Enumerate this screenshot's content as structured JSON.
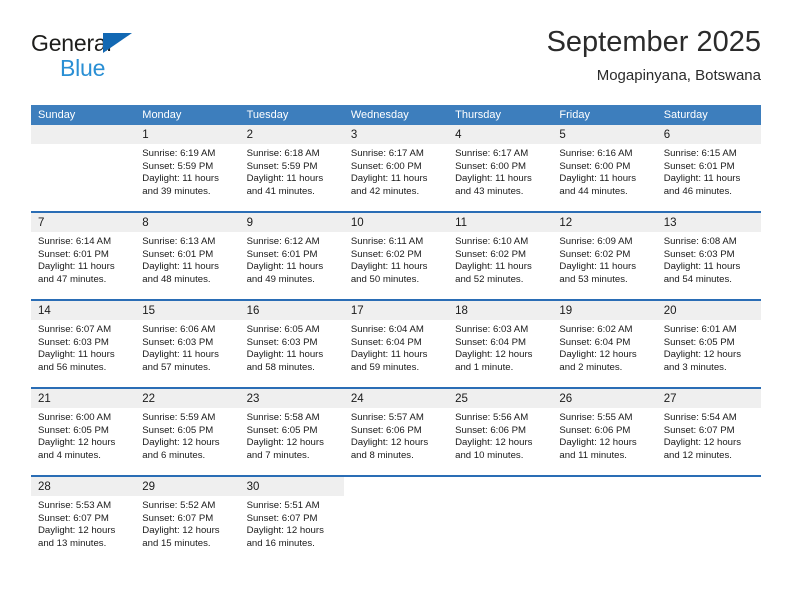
{
  "brand": {
    "line1": "General",
    "line2": "Blue",
    "triangle_color": "#1268b3",
    "blue_text_color": "#2a8fd4"
  },
  "header": {
    "title": "September 2025",
    "subtitle": "Mogapinyana, Botswana"
  },
  "theme": {
    "header_row_bg": "#3d7ebd",
    "week_divider": "#2a6db5",
    "day_number_band": "#efefef"
  },
  "weekdays": [
    "Sunday",
    "Monday",
    "Tuesday",
    "Wednesday",
    "Thursday",
    "Friday",
    "Saturday"
  ],
  "weeks": [
    [
      {
        "day": "",
        "blank": true
      },
      {
        "day": "1",
        "sunrise": "Sunrise: 6:19 AM",
        "sunset": "Sunset: 5:59 PM",
        "daylight1": "Daylight: 11 hours",
        "daylight2": "and 39 minutes."
      },
      {
        "day": "2",
        "sunrise": "Sunrise: 6:18 AM",
        "sunset": "Sunset: 5:59 PM",
        "daylight1": "Daylight: 11 hours",
        "daylight2": "and 41 minutes."
      },
      {
        "day": "3",
        "sunrise": "Sunrise: 6:17 AM",
        "sunset": "Sunset: 6:00 PM",
        "daylight1": "Daylight: 11 hours",
        "daylight2": "and 42 minutes."
      },
      {
        "day": "4",
        "sunrise": "Sunrise: 6:17 AM",
        "sunset": "Sunset: 6:00 PM",
        "daylight1": "Daylight: 11 hours",
        "daylight2": "and 43 minutes."
      },
      {
        "day": "5",
        "sunrise": "Sunrise: 6:16 AM",
        "sunset": "Sunset: 6:00 PM",
        "daylight1": "Daylight: 11 hours",
        "daylight2": "and 44 minutes."
      },
      {
        "day": "6",
        "sunrise": "Sunrise: 6:15 AM",
        "sunset": "Sunset: 6:01 PM",
        "daylight1": "Daylight: 11 hours",
        "daylight2": "and 46 minutes."
      }
    ],
    [
      {
        "day": "7",
        "sunrise": "Sunrise: 6:14 AM",
        "sunset": "Sunset: 6:01 PM",
        "daylight1": "Daylight: 11 hours",
        "daylight2": "and 47 minutes."
      },
      {
        "day": "8",
        "sunrise": "Sunrise: 6:13 AM",
        "sunset": "Sunset: 6:01 PM",
        "daylight1": "Daylight: 11 hours",
        "daylight2": "and 48 minutes."
      },
      {
        "day": "9",
        "sunrise": "Sunrise: 6:12 AM",
        "sunset": "Sunset: 6:01 PM",
        "daylight1": "Daylight: 11 hours",
        "daylight2": "and 49 minutes."
      },
      {
        "day": "10",
        "sunrise": "Sunrise: 6:11 AM",
        "sunset": "Sunset: 6:02 PM",
        "daylight1": "Daylight: 11 hours",
        "daylight2": "and 50 minutes."
      },
      {
        "day": "11",
        "sunrise": "Sunrise: 6:10 AM",
        "sunset": "Sunset: 6:02 PM",
        "daylight1": "Daylight: 11 hours",
        "daylight2": "and 52 minutes."
      },
      {
        "day": "12",
        "sunrise": "Sunrise: 6:09 AM",
        "sunset": "Sunset: 6:02 PM",
        "daylight1": "Daylight: 11 hours",
        "daylight2": "and 53 minutes."
      },
      {
        "day": "13",
        "sunrise": "Sunrise: 6:08 AM",
        "sunset": "Sunset: 6:03 PM",
        "daylight1": "Daylight: 11 hours",
        "daylight2": "and 54 minutes."
      }
    ],
    [
      {
        "day": "14",
        "sunrise": "Sunrise: 6:07 AM",
        "sunset": "Sunset: 6:03 PM",
        "daylight1": "Daylight: 11 hours",
        "daylight2": "and 56 minutes."
      },
      {
        "day": "15",
        "sunrise": "Sunrise: 6:06 AM",
        "sunset": "Sunset: 6:03 PM",
        "daylight1": "Daylight: 11 hours",
        "daylight2": "and 57 minutes."
      },
      {
        "day": "16",
        "sunrise": "Sunrise: 6:05 AM",
        "sunset": "Sunset: 6:03 PM",
        "daylight1": "Daylight: 11 hours",
        "daylight2": "and 58 minutes."
      },
      {
        "day": "17",
        "sunrise": "Sunrise: 6:04 AM",
        "sunset": "Sunset: 6:04 PM",
        "daylight1": "Daylight: 11 hours",
        "daylight2": "and 59 minutes."
      },
      {
        "day": "18",
        "sunrise": "Sunrise: 6:03 AM",
        "sunset": "Sunset: 6:04 PM",
        "daylight1": "Daylight: 12 hours",
        "daylight2": "and 1 minute."
      },
      {
        "day": "19",
        "sunrise": "Sunrise: 6:02 AM",
        "sunset": "Sunset: 6:04 PM",
        "daylight1": "Daylight: 12 hours",
        "daylight2": "and 2 minutes."
      },
      {
        "day": "20",
        "sunrise": "Sunrise: 6:01 AM",
        "sunset": "Sunset: 6:05 PM",
        "daylight1": "Daylight: 12 hours",
        "daylight2": "and 3 minutes."
      }
    ],
    [
      {
        "day": "21",
        "sunrise": "Sunrise: 6:00 AM",
        "sunset": "Sunset: 6:05 PM",
        "daylight1": "Daylight: 12 hours",
        "daylight2": "and 4 minutes."
      },
      {
        "day": "22",
        "sunrise": "Sunrise: 5:59 AM",
        "sunset": "Sunset: 6:05 PM",
        "daylight1": "Daylight: 12 hours",
        "daylight2": "and 6 minutes."
      },
      {
        "day": "23",
        "sunrise": "Sunrise: 5:58 AM",
        "sunset": "Sunset: 6:05 PM",
        "daylight1": "Daylight: 12 hours",
        "daylight2": "and 7 minutes."
      },
      {
        "day": "24",
        "sunrise": "Sunrise: 5:57 AM",
        "sunset": "Sunset: 6:06 PM",
        "daylight1": "Daylight: 12 hours",
        "daylight2": "and 8 minutes."
      },
      {
        "day": "25",
        "sunrise": "Sunrise: 5:56 AM",
        "sunset": "Sunset: 6:06 PM",
        "daylight1": "Daylight: 12 hours",
        "daylight2": "and 10 minutes."
      },
      {
        "day": "26",
        "sunrise": "Sunrise: 5:55 AM",
        "sunset": "Sunset: 6:06 PM",
        "daylight1": "Daylight: 12 hours",
        "daylight2": "and 11 minutes."
      },
      {
        "day": "27",
        "sunrise": "Sunrise: 5:54 AM",
        "sunset": "Sunset: 6:07 PM",
        "daylight1": "Daylight: 12 hours",
        "daylight2": "and 12 minutes."
      }
    ],
    [
      {
        "day": "28",
        "sunrise": "Sunrise: 5:53 AM",
        "sunset": "Sunset: 6:07 PM",
        "daylight1": "Daylight: 12 hours",
        "daylight2": "and 13 minutes."
      },
      {
        "day": "29",
        "sunrise": "Sunrise: 5:52 AM",
        "sunset": "Sunset: 6:07 PM",
        "daylight1": "Daylight: 12 hours",
        "daylight2": "and 15 minutes."
      },
      {
        "day": "30",
        "sunrise": "Sunrise: 5:51 AM",
        "sunset": "Sunset: 6:07 PM",
        "daylight1": "Daylight: 12 hours",
        "daylight2": "and 16 minutes."
      },
      {
        "day": "",
        "blank": true
      },
      {
        "day": "",
        "blank": true
      },
      {
        "day": "",
        "blank": true
      },
      {
        "day": "",
        "blank": true
      }
    ]
  ]
}
